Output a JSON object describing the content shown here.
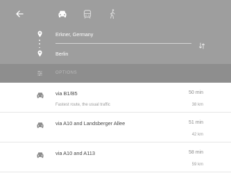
{
  "header": {
    "back_icon": "arrow-left-icon",
    "modes": [
      {
        "icon": "car-icon",
        "active": true
      },
      {
        "icon": "transit-icon",
        "active": false
      },
      {
        "icon": "walk-icon",
        "active": false
      }
    ],
    "origin": "Erkner, Germany",
    "destination": "Berlin",
    "swap_icon": "swap-vertical-icon"
  },
  "options": {
    "label": "OPTIONS",
    "icon": "tune-icon"
  },
  "routes": [
    {
      "name": "via B1/B5",
      "description": "Fastest route, the usual traffic",
      "time": "50 min",
      "distance": "38 km"
    },
    {
      "name": "via A10 and Landsberger Allee",
      "description": "",
      "time": "51 min",
      "distance": "42 km"
    },
    {
      "name": "via A10 and A113",
      "description": "",
      "time": "58 min",
      "distance": "59 km"
    }
  ],
  "colors": {
    "header_bg": "#9e9e9e",
    "options_bg": "#8e8e8e",
    "list_bg": "#ffffff"
  }
}
